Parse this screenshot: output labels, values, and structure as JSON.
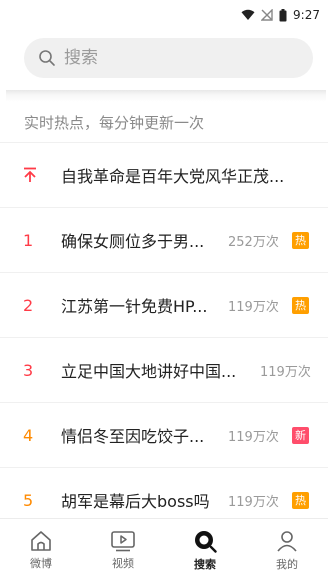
{
  "status_bar": {
    "time": "9:27",
    "icons": [
      "wifi-icon",
      "no-signal-icon",
      "battery-icon"
    ]
  },
  "search": {
    "placeholder": "搜索",
    "icon": "search-icon"
  },
  "hot_section": {
    "header": "实时热点，每分钟更新一次"
  },
  "hot_list": [
    {
      "rank": "",
      "rank_icon": "pin-top-icon",
      "title": "自我革命是百年大党风华正茂...",
      "count": "",
      "tag": ""
    },
    {
      "rank": "1",
      "title": "确保女厕位多于男...",
      "count": "252万次",
      "tag": "热"
    },
    {
      "rank": "2",
      "title": "江苏第一针免费HP...",
      "count": "119万次",
      "tag": "热"
    },
    {
      "rank": "3",
      "title": "立足中国大地讲好中国...",
      "count": "119万次",
      "tag": ""
    },
    {
      "rank": "4",
      "title": "情侣冬至因吃饺子...",
      "count": "119万次",
      "tag": "新"
    },
    {
      "rank": "5",
      "title": "胡军是幕后大boss吗",
      "count": "119万次",
      "tag": "热"
    }
  ],
  "colors": {
    "rank_red": "#ff3b47",
    "rank_orange": "#ff8a00",
    "tag_hot": "#ff9f00",
    "tag_new": "#ff4d6b"
  },
  "tabbar": [
    {
      "label": "微博",
      "icon": "home-icon"
    },
    {
      "label": "视频",
      "icon": "video-icon"
    },
    {
      "label": "搜索",
      "icon": "discover-icon",
      "active": true
    },
    {
      "label": "我的",
      "icon": "profile-icon"
    }
  ]
}
